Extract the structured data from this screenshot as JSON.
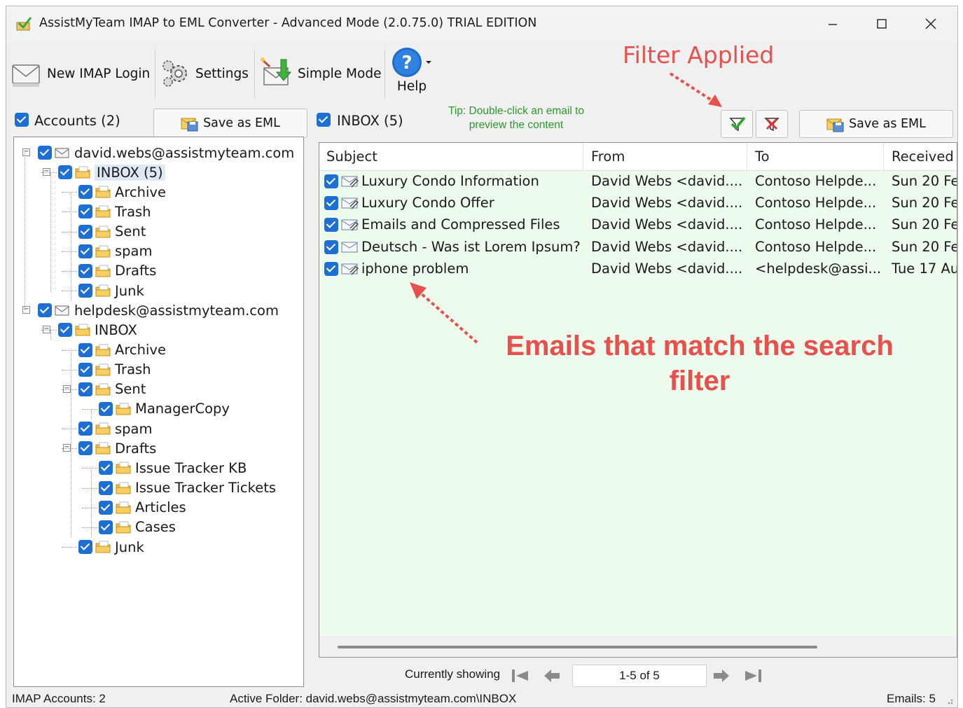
{
  "window": {
    "title": "AssistMyTeam IMAP to EML Converter - Advanced Mode (2.0.75.0) TRIAL EDITION"
  },
  "toolbar": {
    "new_login": "New IMAP Login",
    "settings": "Settings",
    "simple_mode": "Simple Mode",
    "help": "Help"
  },
  "annotations": {
    "filter_applied": "Filter Applied",
    "emails_match_line1": "Emails that match the search",
    "emails_match_line2": "filter"
  },
  "left_pane": {
    "accounts_label": "Accounts (2)",
    "save_button": "Save as EML",
    "tree": [
      {
        "label": "david.webs@assistmyteam.com"
      },
      {
        "label": "INBOX (5)"
      },
      {
        "label": "Archive"
      },
      {
        "label": "Trash"
      },
      {
        "label": "Sent"
      },
      {
        "label": "spam"
      },
      {
        "label": "Drafts"
      },
      {
        "label": "Junk"
      },
      {
        "label": "helpdesk@assistmyteam.com"
      },
      {
        "label": "INBOX"
      },
      {
        "label": "Archive"
      },
      {
        "label": "Trash"
      },
      {
        "label": "Sent"
      },
      {
        "label": "ManagerCopy"
      },
      {
        "label": "spam"
      },
      {
        "label": "Drafts"
      },
      {
        "label": "Issue Tracker KB"
      },
      {
        "label": "Issue Tracker Tickets"
      },
      {
        "label": "Articles"
      },
      {
        "label": "Cases"
      },
      {
        "label": "Junk"
      }
    ]
  },
  "right_pane": {
    "inbox_label": "INBOX (5)",
    "tip": "Tip: Double-click an email to preview the content",
    "save_button": "Save as EML",
    "columns": [
      "Subject",
      "From",
      "To",
      "Received"
    ],
    "rows": [
      [
        "Luxury Condo Information",
        "David Webs <david....",
        "Contoso Helpde...",
        "Sun 20 Fe"
      ],
      [
        "Luxury Condo Offer",
        "David Webs <david....",
        "Contoso Helpde...",
        "Sun 20 Fe"
      ],
      [
        "Emails and Compressed Files",
        "David Webs <david....",
        "Contoso Helpde...",
        "Sun 20 Fe"
      ],
      [
        "Deutsch - Was ist Lorem Ipsum?",
        "David Webs <david....",
        "Contoso Helpde...",
        "Sun 20 Fe"
      ],
      [
        "iphone problem",
        "David Webs <david....",
        "<helpdesk@assi...",
        "Tue 17 Au"
      ]
    ]
  },
  "pager": {
    "showing_label": "Currently showing",
    "range": "1-5 of 5"
  },
  "status": {
    "accounts": "IMAP Accounts: 2",
    "active_folder": "Active Folder: david.webs@assistmyteam.com\\INBOX",
    "emails": "Emails: 5"
  },
  "colors": {
    "accent_check": "#1e6fd4",
    "annotation_red": "#e8504d",
    "grid_background": "#ecfbeb",
    "tip_green": "#2a9a2a"
  }
}
